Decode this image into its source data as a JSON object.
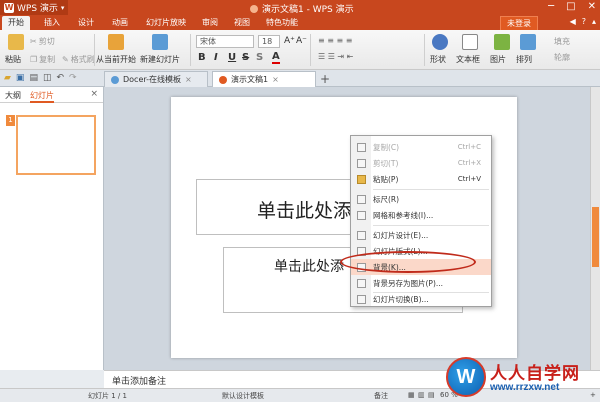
{
  "app": {
    "name": "WPS 演示",
    "logo_glyph": "W",
    "caret": "▾",
    "title": "演示文稿1 - WPS 演示",
    "window_controls": [
      "─",
      "□",
      "✕"
    ]
  },
  "menu": {
    "tabs": [
      "开始",
      "插入",
      "设计",
      "动画",
      "幻灯片放映",
      "审阅",
      "视图",
      "特色功能"
    ],
    "login": "未登录",
    "right": [
      "◀",
      "?",
      "▴"
    ]
  },
  "ribbon": {
    "paste": "粘贴",
    "cut": "剪切",
    "copy": "复制",
    "format_painter": "格式刷",
    "from_current": "从当前开始",
    "new_slide": "新建幻灯片",
    "font_name": "宋体",
    "font_size": "18",
    "grow": "A⁺",
    "shrink": "A⁻",
    "bold": "B",
    "italic": "I",
    "underline": "U",
    "strike": "S",
    "shadow": "S",
    "font_color": "A",
    "shape": "形状",
    "textbox": "文本框",
    "picture": "图片",
    "arrange": "排列",
    "fill": "填充",
    "outline": "轮廓"
  },
  "docbar": {
    "tabs": [
      {
        "label": "Docer-在线模板",
        "close": "×"
      },
      {
        "label": "演示文稿1",
        "close": "×"
      }
    ],
    "add": "+"
  },
  "leftpane": {
    "tabs": [
      "大纲",
      "幻灯片"
    ],
    "close": "×",
    "slide_number": "1"
  },
  "slide": {
    "title_placeholder": "单击此处添",
    "subtitle_placeholder": "单击此处添"
  },
  "context_menu": {
    "items": [
      {
        "label": "复制(C)",
        "shortcut": "Ctrl+C",
        "disabled": true
      },
      {
        "label": "剪切(T)",
        "shortcut": "Ctrl+X",
        "disabled": true
      },
      {
        "label": "粘贴(P)",
        "shortcut": "Ctrl+V",
        "disabled": false
      },
      {
        "label": "标尺(R)",
        "shortcut": "",
        "disabled": false
      },
      {
        "label": "网格和参考线(I)...",
        "shortcut": "",
        "disabled": false
      },
      {
        "label": "幻灯片设计(E)...",
        "shortcut": "",
        "disabled": false
      },
      {
        "label": "幻灯片版式(L)...",
        "shortcut": "",
        "disabled": false
      },
      {
        "label": "背景(K)...",
        "shortcut": "",
        "disabled": false,
        "highlighted": true
      },
      {
        "label": "背景另存为图片(P)...",
        "shortcut": "",
        "disabled": false
      },
      {
        "label": "幻灯片切换(B)...",
        "shortcut": "",
        "disabled": false
      }
    ]
  },
  "notes": {
    "placeholder": "单击添加备注"
  },
  "status": {
    "slide_count": "幻灯片 1 / 1",
    "template": "默认设计模板",
    "notes": "备注",
    "zoom": "60 %",
    "zoom_minus": "−",
    "zoom_plus": "+"
  },
  "watermark": {
    "logo_glyph": "W",
    "title": "人人自学网",
    "url": "www.rrzxw.net"
  },
  "colors": {
    "accent": "#c8471e",
    "highlight": "#fbd8c9",
    "annotation": "#c02a1a"
  }
}
